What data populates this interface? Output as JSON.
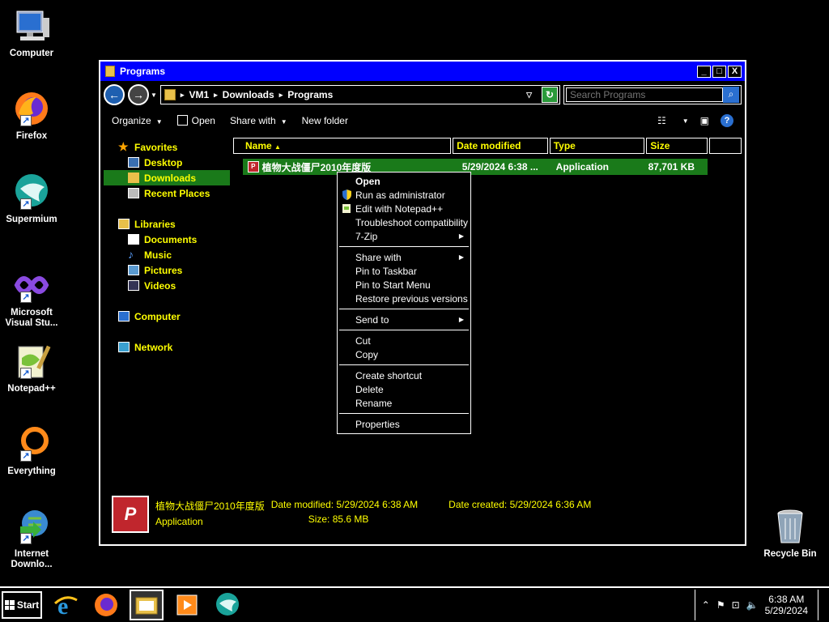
{
  "desktop": {
    "icons": [
      {
        "label": "Computer"
      },
      {
        "label": "Firefox"
      },
      {
        "label": "Supermium"
      },
      {
        "label": "Microsoft Visual Stu..."
      },
      {
        "label": "Notepad++"
      },
      {
        "label": "Everything"
      },
      {
        "label": "Internet Downlo..."
      }
    ],
    "recycle_bin": "Recycle Bin"
  },
  "window": {
    "title": "Programs",
    "controls": {
      "minimize": "_",
      "maximize": "□",
      "close": "X"
    },
    "address": {
      "segments": [
        "VM1",
        "Downloads",
        "Programs"
      ]
    },
    "search": {
      "placeholder": "Search Programs"
    },
    "toolbar": {
      "organize": "Organize",
      "open": "Open",
      "share_with": "Share with",
      "new_folder": "New folder",
      "help": "?"
    },
    "nav": {
      "favorites": "Favorites",
      "desktop": "Desktop",
      "downloads": "Downloads",
      "recent_places": "Recent Places",
      "libraries": "Libraries",
      "documents": "Documents",
      "music": "Music",
      "pictures": "Pictures",
      "videos": "Videos",
      "computer": "Computer",
      "network": "Network"
    },
    "columns": {
      "name": "Name",
      "date_modified": "Date modified",
      "type": "Type",
      "size": "Size"
    },
    "file": {
      "name": "植物大战僵尸2010年度版",
      "date_modified": "5/29/2024 6:38 ...",
      "type": "Application",
      "size": "87,701 KB"
    },
    "details": {
      "name": "植物大战僵尸2010年度版",
      "type": "Application",
      "date_modified_label": "Date modified:",
      "date_modified": "5/29/2024 6:38 AM",
      "size_label": "Size:",
      "size": "85.6 MB",
      "date_created_label": "Date created:",
      "date_created": "5/29/2024 6:36 AM"
    }
  },
  "context_menu": {
    "open": "Open",
    "run_as_admin": "Run as administrator",
    "edit_notepad": "Edit with Notepad++",
    "troubleshoot": "Troubleshoot compatibility",
    "seven_zip": "7-Zip",
    "share_with": "Share with",
    "pin_taskbar": "Pin to Taskbar",
    "pin_start": "Pin to Start Menu",
    "restore": "Restore previous versions",
    "send_to": "Send to",
    "cut": "Cut",
    "copy": "Copy",
    "create_shortcut": "Create shortcut",
    "delete": "Delete",
    "rename": "Rename",
    "properties": "Properties"
  },
  "taskbar": {
    "start": "Start",
    "time": "6:38 AM",
    "date": "5/29/2024"
  }
}
